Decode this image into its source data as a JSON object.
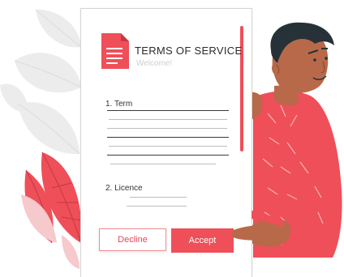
{
  "terms": {
    "title": "TERMS OF SERVICE",
    "subtitle": "Welcome!",
    "sections": [
      {
        "label": "1. Term"
      },
      {
        "label": "2. Licence"
      }
    ],
    "decline_label": "Decline",
    "accept_label": "Accept"
  },
  "colors": {
    "accent": "#ef4f58",
    "skin": "#b8694a",
    "hair": "#263238",
    "leaf_gray": "#ebebeb"
  },
  "icons": [
    "document-icon"
  ]
}
